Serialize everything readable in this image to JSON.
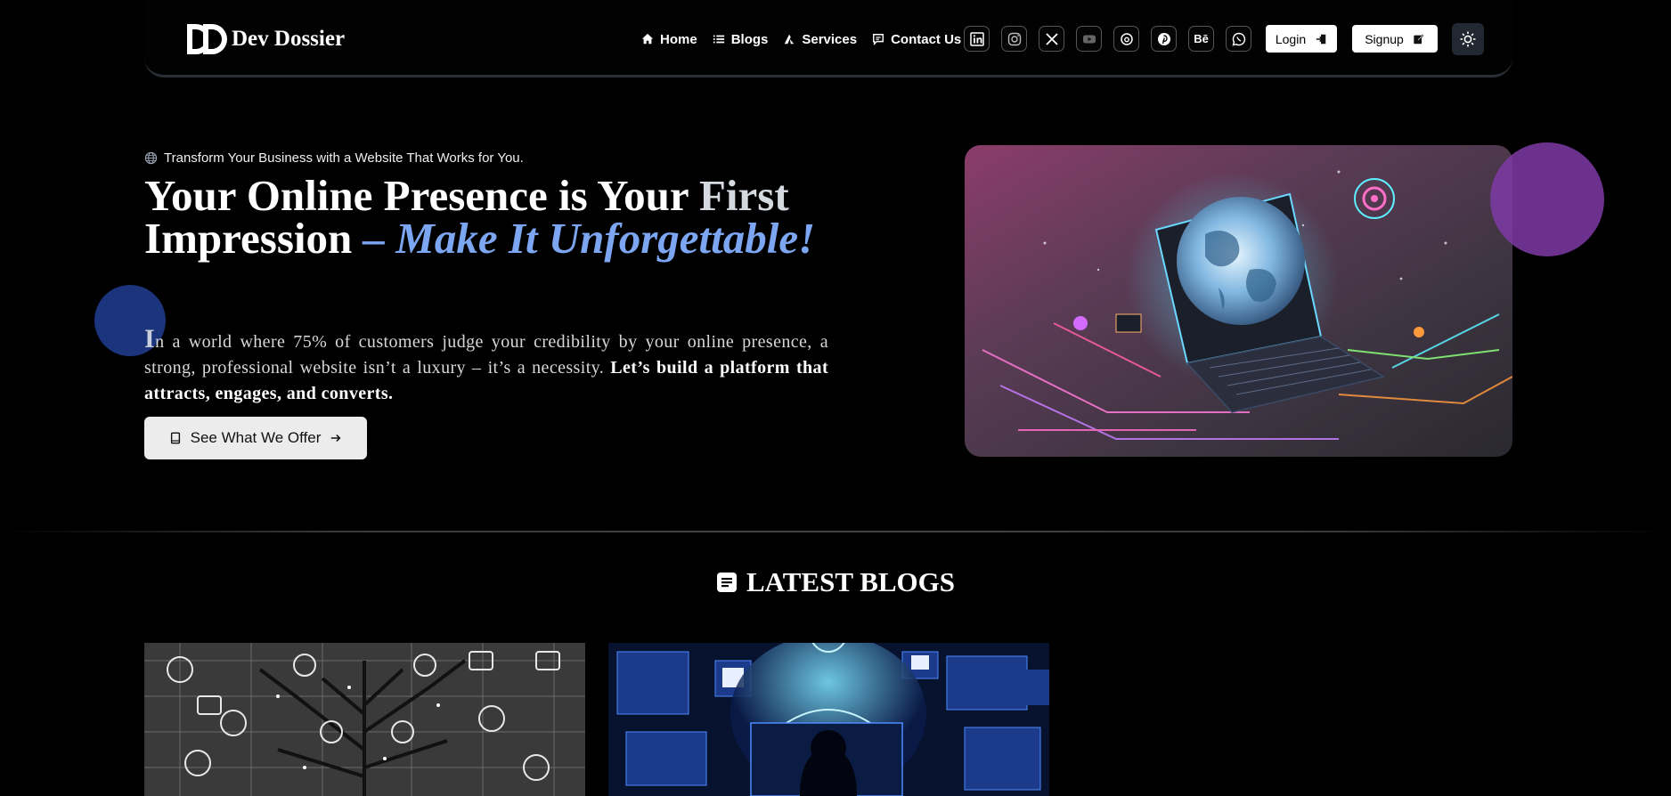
{
  "brand": {
    "name": "Dev Dossier",
    "logo_letters": "DD"
  },
  "nav": {
    "links": [
      {
        "label": "Home",
        "icon": "home-icon"
      },
      {
        "label": "Blogs",
        "icon": "list-icon"
      },
      {
        "label": "Services",
        "icon": "services-icon"
      },
      {
        "label": "Contact Us",
        "icon": "chat-icon"
      }
    ],
    "socials": [
      "linkedin-icon",
      "instagram-icon",
      "x-icon",
      "youtube-icon",
      "threads-icon",
      "pinterest-icon",
      "behance-icon",
      "whatsapp-icon"
    ],
    "behance_text": "Bē",
    "login_label": "Login",
    "signup_label": "Signup",
    "theme_icon": "sun-icon"
  },
  "hero": {
    "tagline": "Transform Your Business with a Website That Works for You.",
    "title_part1": "Your Online Presence is Your ",
    "title_part2": "First",
    "title_part3": "Impression ",
    "title_accent": "– Make It Unforgettable!",
    "para_cap": "I",
    "para_text": "n a world where 75% of customers judge your credibility by your online presence, a strong, professional website isn’t a luxury – it’s a necessity. ",
    "para_bold": "Let’s build a platform that attracts, engages, and converts.",
    "cta_label": "See What We Offer",
    "image_alt": "laptop-globe-illustration"
  },
  "blogs": {
    "section_title": "LATEST BLOGS",
    "cards": [
      {
        "image": "tech-tree-network-image"
      },
      {
        "image": "cyber-hologram-image"
      }
    ]
  },
  "colors": {
    "background": "#000000",
    "accent": "#7ca6f2",
    "blob_blue": "#1e3a8a",
    "blob_purple": "#7e3aa6"
  }
}
